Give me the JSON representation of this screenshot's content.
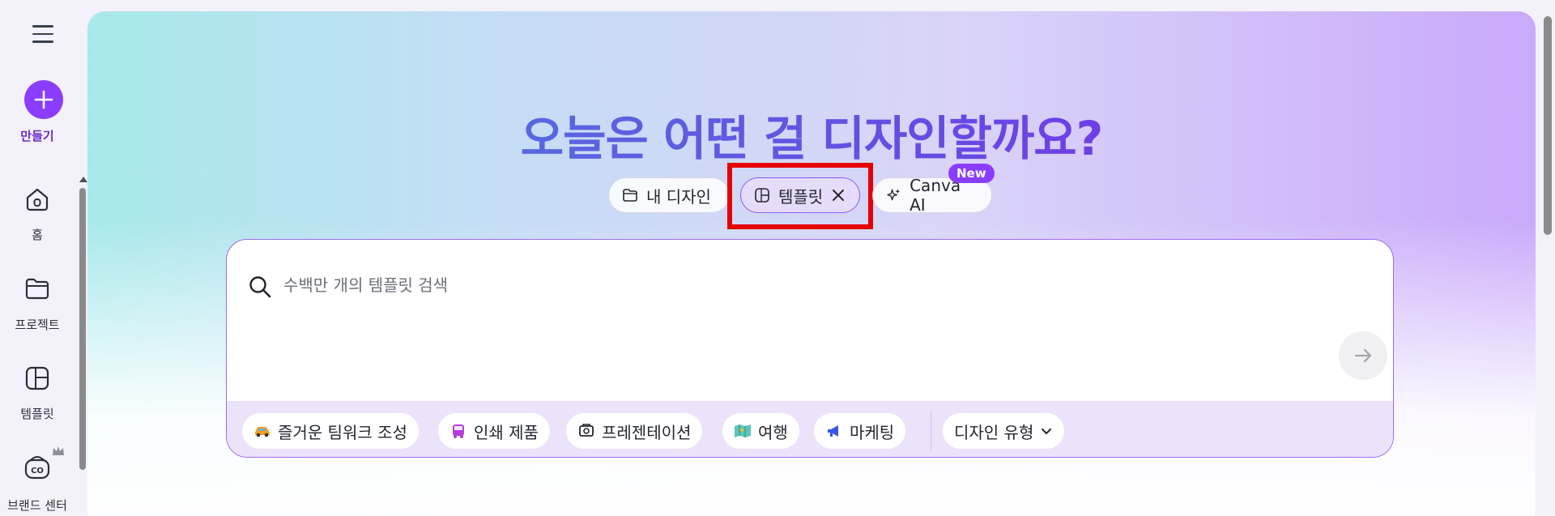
{
  "sidebar": {
    "create_label": "만들기",
    "items": [
      {
        "label": "홈",
        "icon": "home-icon"
      },
      {
        "label": "프로젝트",
        "icon": "folder-icon"
      },
      {
        "label": "템플릿",
        "icon": "template-icon"
      },
      {
        "label": "브랜드 센터",
        "icon": "brand-center-icon"
      }
    ]
  },
  "main": {
    "headline": "오늘은 어떤 걸 디자인할까요?",
    "tabs": {
      "my_designs": "내 디자인",
      "templates": "템플릿",
      "canva_ai": "Canva AI",
      "new_badge": "New"
    },
    "search": {
      "placeholder": "수백만 개의 템플릿 검색",
      "value": ""
    },
    "chips": [
      {
        "label": "즐거운 팀워크 조성",
        "icon": "car-icon"
      },
      {
        "label": "인쇄 제품",
        "icon": "bus-icon"
      },
      {
        "label": "프레젠테이션",
        "icon": "presentation-icon"
      },
      {
        "label": "여행",
        "icon": "map-icon"
      },
      {
        "label": "마케팅",
        "icon": "megaphone-icon"
      }
    ],
    "design_type_label": "디자인 유형"
  },
  "colors": {
    "accent": "#8b3dff",
    "highlight": "#e60000"
  }
}
